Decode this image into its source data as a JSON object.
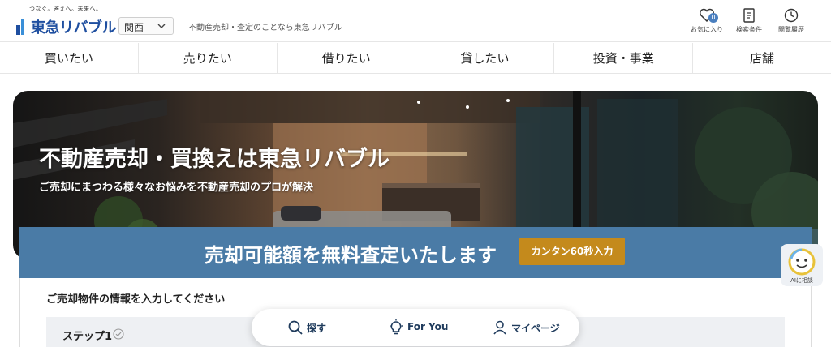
{
  "header": {
    "logo_tagline": "つなぐ。答えへ。未来へ。",
    "logo_text": "東急リバブル",
    "region_selected": "関西",
    "tagline": "不動産売却・査定のことなら東急リバブル",
    "favorites": {
      "label": "お気に入り",
      "count": "0",
      "icon": "heart-icon"
    },
    "search_conditions": {
      "label": "検索条件",
      "icon": "document-icon"
    },
    "history": {
      "label": "閲覧履歴",
      "icon": "clock-icon"
    }
  },
  "nav": {
    "items": [
      "買いたい",
      "売りたい",
      "借りたい",
      "貸したい",
      "投資・事業",
      "店舗"
    ]
  },
  "hero": {
    "title": "不動産売却・買換えは東急リバブル",
    "subtitle": "ご売却にまつわる様々なお悩みを不動産売却のプロが解決"
  },
  "banner": {
    "text": "売却可能額を無料査定いたします",
    "button": "カンタン60秒入力"
  },
  "form": {
    "heading": "ご売却物件の情報を入力してください",
    "step_label": "ステップ1"
  },
  "ai_assistant": {
    "label": "AIに相談",
    "icon": "smiley-icon"
  },
  "bottom_nav": {
    "search": {
      "label": "探す",
      "icon": "search-icon"
    },
    "for_you": {
      "label": "For You",
      "icon": "lightbulb-icon"
    },
    "mypage": {
      "label": "マイページ",
      "icon": "person-icon"
    }
  },
  "colors": {
    "brand_blue": "#1f4fa0",
    "banner_blue": "#4a7ba6",
    "cta_gold": "#c48a1c"
  }
}
